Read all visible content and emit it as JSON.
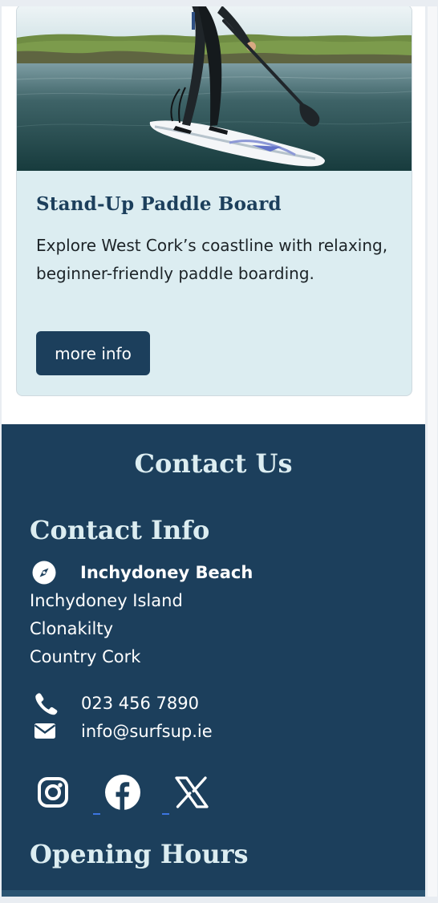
{
  "card": {
    "image_alt": "Person stand-up paddle boarding on calm coastal water",
    "title": "Stand-Up Paddle Board",
    "description": "Explore West Cork’s coastline with relaxing, beginner-friendly paddle boarding.",
    "button_label": "more info"
  },
  "contact": {
    "heading": "Contact Us",
    "info_heading": "Contact Info",
    "location_name": "Inchydoney Beach",
    "address_lines": [
      "Inchydoney Island",
      "Clonakilty",
      "Country Cork"
    ],
    "phone": "023 456 7890",
    "email": "info@surfsup.ie",
    "icons": [
      "compass-icon",
      "phone-icon",
      "envelope-icon"
    ],
    "social": [
      "instagram-icon",
      "facebook-icon",
      "x-icon"
    ],
    "hours_heading": "Opening Hours"
  },
  "colors": {
    "navy": "#1c3f5c",
    "light_blue": "#dcedf1",
    "white": "#ffffff"
  }
}
